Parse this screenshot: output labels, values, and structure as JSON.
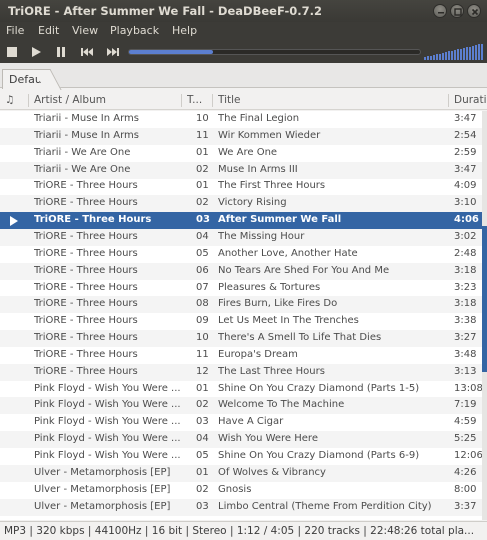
{
  "window": {
    "title": "TriORE - After Summer We Fall - DeaDBeeF-0.7.2"
  },
  "menu": [
    "File",
    "Edit",
    "View",
    "Playback",
    "Help"
  ],
  "playback": {
    "progress_fraction": 0.29,
    "volume_fraction": 1.0
  },
  "tabs": [
    {
      "label": "Default"
    }
  ],
  "columns": {
    "playing": "♫",
    "artist_album": "Artist / Album",
    "track": "T...",
    "title": "Title",
    "duration": "Durati"
  },
  "tracks": [
    {
      "artist_album": "Triarii - Muse In Arms",
      "track": "10",
      "title": "The Final Legion",
      "duration": "3:47"
    },
    {
      "artist_album": "Triarii - Muse In Arms",
      "track": "11",
      "title": "Wir Kommen Wieder",
      "duration": "2:54"
    },
    {
      "artist_album": "Triarii - We Are One",
      "track": "01",
      "title": "We Are One",
      "duration": "2:59"
    },
    {
      "artist_album": "Triarii - We Are One",
      "track": "02",
      "title": "Muse In Arms III",
      "duration": "3:47"
    },
    {
      "artist_album": "TriORE - Three Hours",
      "track": "01",
      "title": "The First Three Hours",
      "duration": "4:09"
    },
    {
      "artist_album": "TriORE - Three Hours",
      "track": "02",
      "title": "Victory Rising",
      "duration": "3:10"
    },
    {
      "artist_album": "TriORE - Three Hours",
      "track": "03",
      "title": "After Summer We Fall",
      "duration": "4:06",
      "playing": true
    },
    {
      "artist_album": "TriORE - Three Hours",
      "track": "04",
      "title": "The Missing Hour",
      "duration": "3:02"
    },
    {
      "artist_album": "TriORE - Three Hours",
      "track": "05",
      "title": "Another Love, Another Hate",
      "duration": "2:48"
    },
    {
      "artist_album": "TriORE - Three Hours",
      "track": "06",
      "title": "No Tears Are Shed For You And Me",
      "duration": "3:18"
    },
    {
      "artist_album": "TriORE - Three Hours",
      "track": "07",
      "title": "Pleasures & Tortures",
      "duration": "3:23"
    },
    {
      "artist_album": "TriORE - Three Hours",
      "track": "08",
      "title": "Fires Burn, Like Fires Do",
      "duration": "3:18"
    },
    {
      "artist_album": "TriORE - Three Hours",
      "track": "09",
      "title": "Let Us Meet In The Trenches",
      "duration": "3:38"
    },
    {
      "artist_album": "TriORE - Three Hours",
      "track": "10",
      "title": "There's A Smell To Life That Dies",
      "duration": "3:27"
    },
    {
      "artist_album": "TriORE - Three Hours",
      "track": "11",
      "title": "Europa's Dream",
      "duration": "3:48"
    },
    {
      "artist_album": "TriORE - Three Hours",
      "track": "12",
      "title": "The Last Three Hours",
      "duration": "3:13"
    },
    {
      "artist_album": "Pink Floyd - Wish You Were ...",
      "track": "01",
      "title": "Shine On You Crazy Diamond (Parts 1-5)",
      "duration": "13:08"
    },
    {
      "artist_album": "Pink Floyd - Wish You Were ...",
      "track": "02",
      "title": "Welcome To The Machine",
      "duration": "7:19"
    },
    {
      "artist_album": "Pink Floyd - Wish You Were ...",
      "track": "03",
      "title": "Have A Cigar",
      "duration": "4:59"
    },
    {
      "artist_album": "Pink Floyd - Wish You Were ...",
      "track": "04",
      "title": "Wish You Were Here",
      "duration": "5:25"
    },
    {
      "artist_album": "Pink Floyd - Wish You Were ...",
      "track": "05",
      "title": "Shine On You Crazy Diamond (Parts 6-9)",
      "duration": "12:06"
    },
    {
      "artist_album": "Ulver - Metamorphosis [EP]",
      "track": "01",
      "title": "Of Wolves & Vibrancy",
      "duration": "4:26"
    },
    {
      "artist_album": "Ulver - Metamorphosis [EP]",
      "track": "02",
      "title": "Gnosis",
      "duration": "8:00"
    },
    {
      "artist_album": "Ulver - Metamorphosis [EP]",
      "track": "03",
      "title": "Limbo Central (Theme From Perdition City)",
      "duration": "3:37"
    }
  ],
  "status": {
    "text": "MP3 | 320 kbps | 44100Hz | 16 bit | Stereo | 1:12 / 4:05 | 220 tracks | 22:48:26 total pla..."
  },
  "colors": {
    "accent": "#3465a4",
    "titlebar": "#3c3b37",
    "seek": "#5c7fd0"
  }
}
